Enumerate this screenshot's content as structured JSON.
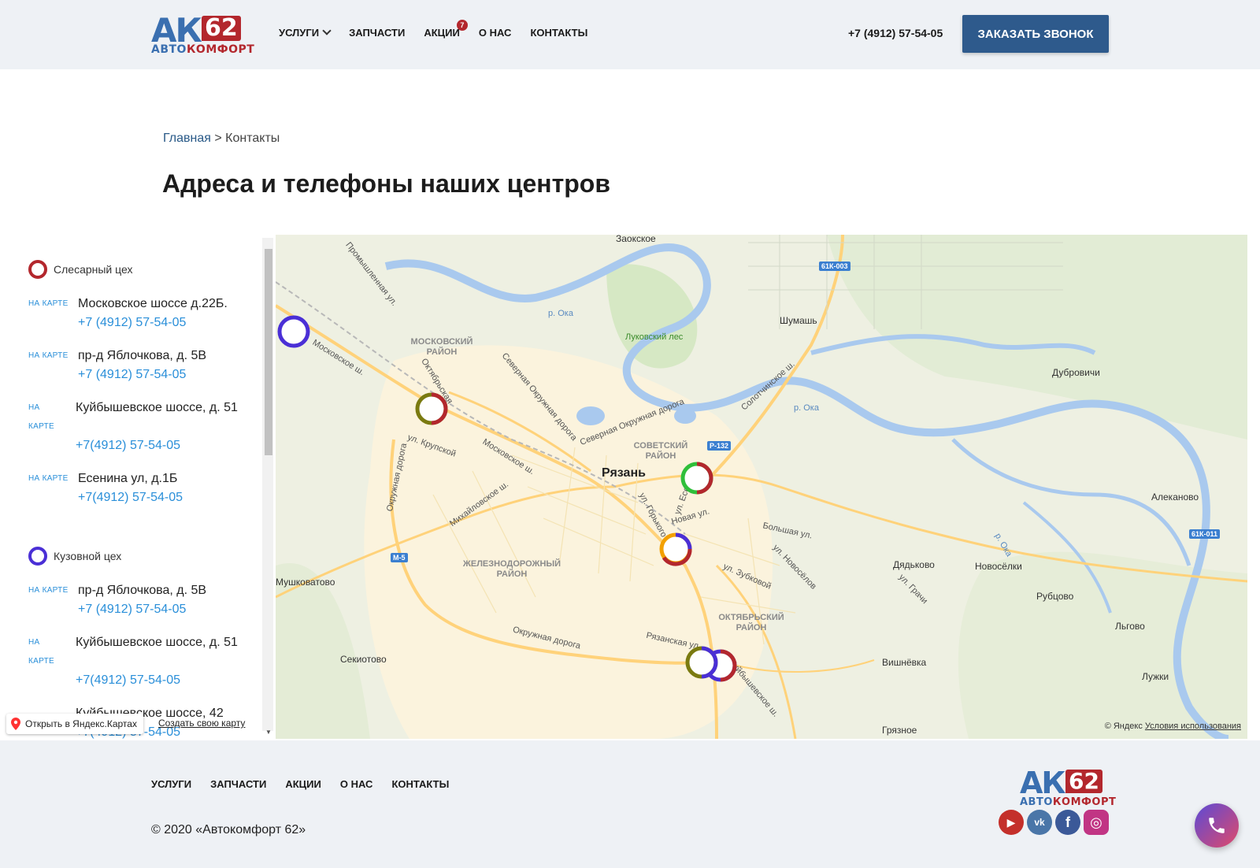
{
  "header": {
    "logo": {
      "ak": "АК",
      "num": "62",
      "sub_a": "АВТО",
      "sub_b": "КОМФОРТ"
    },
    "nav": [
      {
        "label": "Услуги",
        "has_dropdown": true
      },
      {
        "label": "Запчасти"
      },
      {
        "label": "Акции",
        "badge": "7"
      },
      {
        "label": "О нас"
      },
      {
        "label": "Контакты"
      }
    ],
    "phone": "+7 (4912) 57-54-05",
    "call_button": "Заказать звонок"
  },
  "breadcrumb": {
    "home": "Главная",
    "separator": ">",
    "current": "Контакты"
  },
  "page_title": "Адреса и телефоны наших центров",
  "sidebar": {
    "on_map_label": "на карте",
    "on_map_wrap": [
      "на",
      "карте"
    ],
    "groups": [
      {
        "title": "Слесарный цех",
        "ring_color": "#b3272d",
        "entries": [
          {
            "address": "Московское шоссе д.22Б.",
            "phone": "+7 (4912) 57-54-05"
          },
          {
            "address": "пр-д Яблочкова, д. 5В",
            "phone": "+7 (4912) 57-54-05"
          },
          {
            "address": "Куйбышевское шоссе, д. 51",
            "phone": "+7(4912) 57-54-05"
          },
          {
            "address": "Есенина ул, д.1Б",
            "phone": "+7(4912) 57-54-05"
          }
        ]
      },
      {
        "title": "Кузовной цех",
        "ring_color": "#4a2fd6",
        "entries": [
          {
            "address": "пр-д Яблочкова, д. 5В",
            "phone": "+7 (4912) 57-54-05"
          },
          {
            "address": "Куйбышевское шоссе, д. 51",
            "phone": "+7(4912) 57-54-05"
          },
          {
            "address": "Куйбышевское шоссе, 42",
            "phone": "+7(4912) 57-54-05"
          }
        ]
      }
    ]
  },
  "map": {
    "open_yandex": "Открыть в Яндекс.Картах",
    "create_map": "Создать свою карту",
    "credit": "© Яндекс",
    "terms": "Условия использования",
    "labels": {
      "zaokskoe": "Заокское",
      "shumash": "Шумашь",
      "dubrovichi": "Дубровичи",
      "lukovsky": "Луковский лес",
      "moskovsky": "МОСКОВСКИЙ РАЙОН",
      "sovetsky": "СОВЕТСКИЙ РАЙОН",
      "ryazan": "Рязань",
      "zheleznodorozhny": "ЖЕЛЕЗНОДОРОЖНЫЙ РАЙОН",
      "oktyabrsky": "ОКТЯБРЬСКИЙ РАЙОН",
      "mushkovatovo": "Мушковатово",
      "sekiotovo": "Секиотово",
      "dyadkovo": "Дядьково",
      "novosyolki": "Новосёлки",
      "rubtsovo": "Рубцово",
      "alekanovo": "Алеканово",
      "lgovo": "Льгово",
      "vishnyovka": "Вишнёвка",
      "luzhki": "Лужки",
      "gryaznoe": "Грязное",
      "oka1": "р. Ока",
      "oka2": "р. Ока",
      "oka3": "р. Ока",
      "moskovskoe_sh": "Московское ш.",
      "moskovskoe_sh2": "Московское ш.",
      "severnaya_doroga": "Северная Окружная дорога",
      "severnaya_doroga2": "Северная Окружная дорога",
      "promyshlennaya": "Промышленная ул.",
      "oktyabrskaya": "Октябрьская",
      "krupskoy": "ул. Крупской",
      "okruzhnaya": "Окружная дорога",
      "okruzhnaya2": "Окружная дорога",
      "mikhaylovskoe": "Михайловское ш.",
      "gorkogo": "ул. Горького",
      "novaya": "Новая ул.",
      "zubkovoy": "ул. Зубковой",
      "novosyolov": "ул. Новосёлов",
      "bolshaya": "Большая ул.",
      "grachi": "ул. Грачи",
      "ryazanskaya": "Рязанская ул.",
      "kuybyshevskoe": "Куйбышевское ш.",
      "solotchinskoe": "Солотчинское ш.",
      "esenina": "ул. Есенина",
      "moskovskoe_short": "Мо",
      "oktyabrsky_short": "ш."
    },
    "road_badges": {
      "r1": "61К-003",
      "r2": "Р-132",
      "r3": "М-5",
      "r4": "61К-011"
    }
  },
  "footer": {
    "nav": [
      "Услуги",
      "Запчасти",
      "Акции",
      "О нас",
      "Контакты"
    ],
    "copyright": "© 2020 «Автокомфорт 62»",
    "socials": [
      {
        "name": "youtube",
        "glyph": "▶",
        "color": "#c4302b"
      },
      {
        "name": "vk",
        "glyph": "vk",
        "color": "#4a76a8"
      },
      {
        "name": "facebook",
        "glyph": "f",
        "color": "#3b5998"
      },
      {
        "name": "instagram",
        "glyph": "◎",
        "color": "#c13584"
      }
    ]
  },
  "colors": {
    "red": "#b3272d",
    "blue_purple": "#4a2fd6",
    "olive": "#7a7a10",
    "green": "#2fbf3a",
    "orange": "#f3a000",
    "link": "#2a8fd9",
    "brand_blue": "#3a6fb0"
  }
}
